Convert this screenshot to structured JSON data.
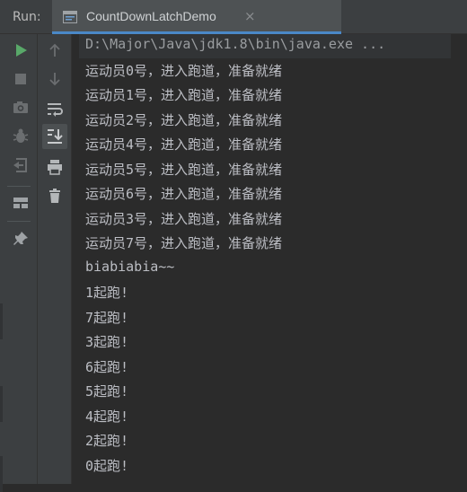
{
  "run_panel": {
    "label": "Run:",
    "tab": {
      "title": "CountDownLatchDemo",
      "close_glyph": "×"
    }
  },
  "toolbar_left": [
    {
      "name": "rerun-icon",
      "color": "#59a869"
    },
    {
      "name": "stop-icon"
    },
    {
      "name": "camera-icon"
    },
    {
      "name": "debug-icon"
    },
    {
      "name": "exit-icon"
    },
    {
      "name": "layout-icon"
    },
    {
      "name": "pin-icon"
    }
  ],
  "toolbar_right": [
    {
      "name": "up-arrow-icon"
    },
    {
      "name": "down-arrow-icon"
    },
    {
      "name": "soft-wrap-icon"
    },
    {
      "name": "scroll-to-end-icon"
    },
    {
      "name": "print-icon"
    },
    {
      "name": "trash-icon"
    }
  ],
  "console": {
    "command": "D:\\Major\\Java\\jdk1.8\\bin\\java.exe ...",
    "lines": [
      "运动员0号，进入跑道，准备就绪",
      "运动员1号，进入跑道，准备就绪",
      "运动员2号，进入跑道，准备就绪",
      "运动员4号，进入跑道，准备就绪",
      "运动员5号，进入跑道，准备就绪",
      "运动员6号，进入跑道，准备就绪",
      "运动员3号，进入跑道，准备就绪",
      "运动员7号，进入跑道，准备就绪",
      "biabiabia~~",
      "1起跑!",
      "7起跑!",
      "3起跑!",
      "6起跑!",
      "5起跑!",
      "4起跑!",
      "2起跑!",
      "0起跑!"
    ]
  },
  "colors": {
    "background": "#2b2b2b",
    "panel": "#3c3f41",
    "accent_tab_underline": "#4a88c7",
    "text": "#bcbec4"
  }
}
